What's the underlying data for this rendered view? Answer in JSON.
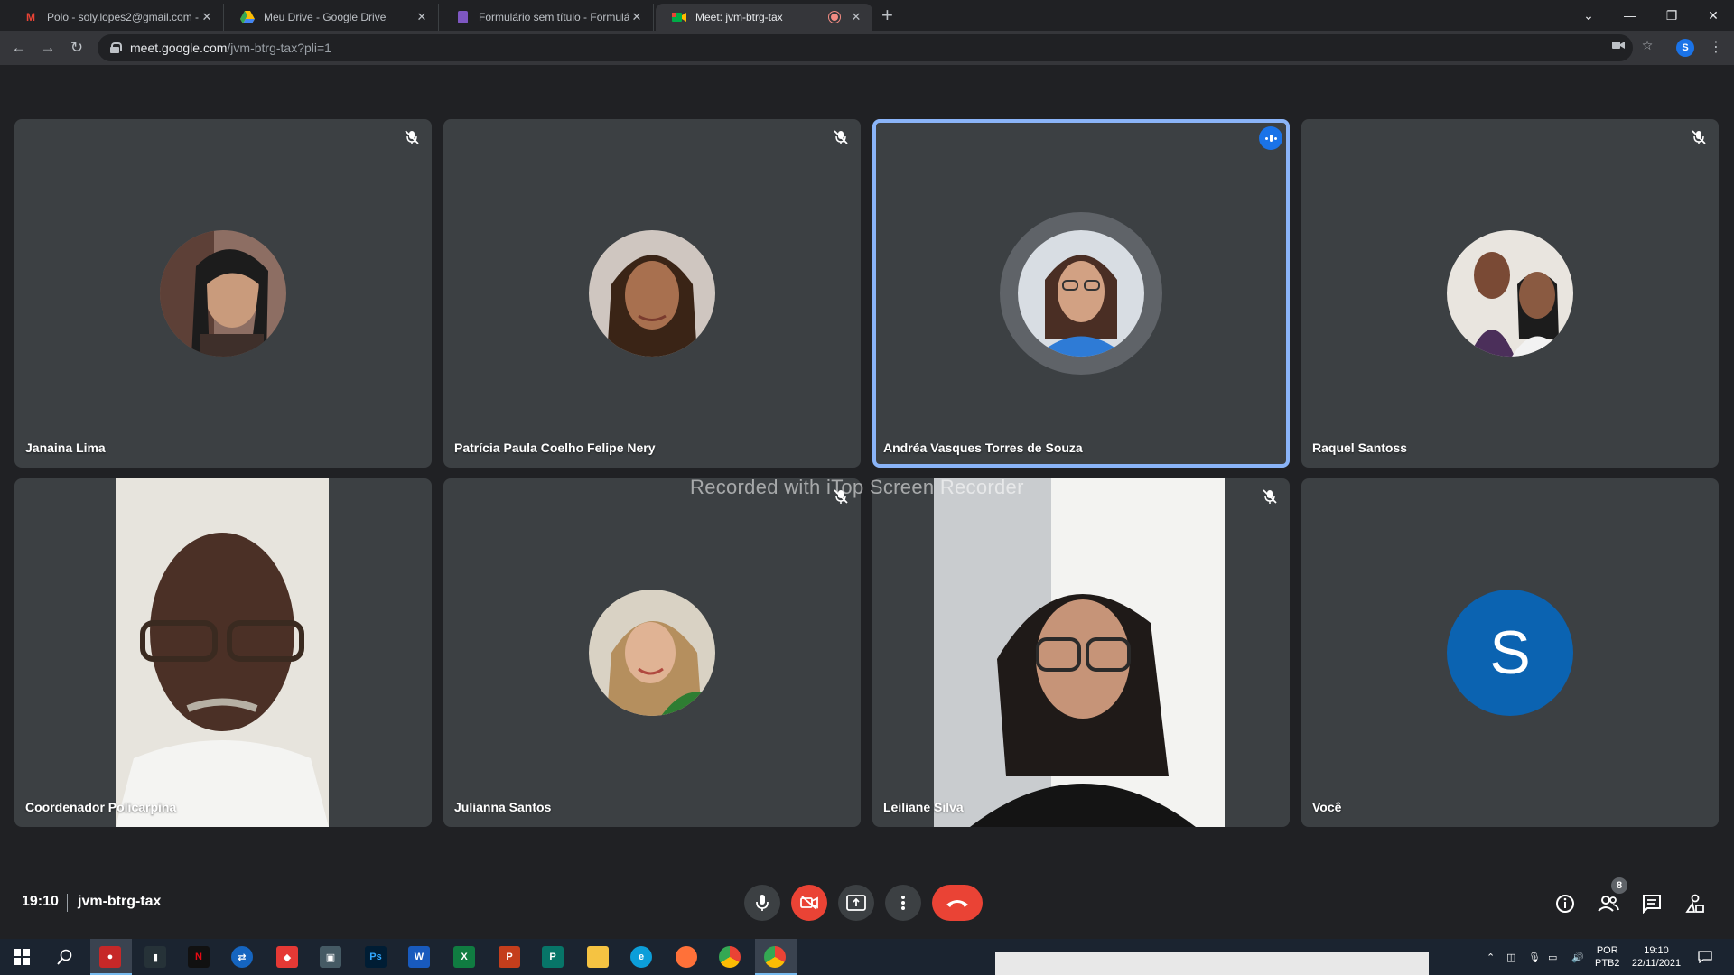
{
  "browser": {
    "tabs": [
      {
        "title": "Polo - soly.lopes2@gmail.com - G",
        "favicon": "gmail-icon"
      },
      {
        "title": "Meu Drive - Google Drive",
        "favicon": "drive-icon"
      },
      {
        "title": "Formulário sem título - Formulár",
        "favicon": "forms-icon"
      },
      {
        "title": "Meet: jvm-btrg-tax",
        "favicon": "meet-icon"
      }
    ],
    "url_host": "meet.google.com",
    "url_path": "/jvm-btrg-tax?pli=1",
    "profile_initial": "S"
  },
  "meeting": {
    "time": "19:10",
    "code": "jvm-btrg-tax",
    "participant_count": "8",
    "watermark": "Recorded with iTop Screen Recorder",
    "participants": [
      {
        "name": "Janaina Lima",
        "muted": true
      },
      {
        "name": "Patrícia Paula Coelho Felipe Nery",
        "muted": true
      },
      {
        "name": "Andréa Vasques Torres de Souza",
        "speaking": true
      },
      {
        "name": "Raquel Santoss",
        "muted": true
      },
      {
        "name": "Coordenador Policarpina",
        "video": true
      },
      {
        "name": "Julianna Santos",
        "muted": true
      },
      {
        "name": "Leiliane Silva",
        "muted": true,
        "video": true
      },
      {
        "name": "Você",
        "initial": "S"
      }
    ]
  },
  "taskbar": {
    "lang_line1": "POR",
    "lang_line2": "PTB2",
    "clock_time": "19:10",
    "clock_date": "22/11/2021",
    "apps": [
      "W",
      "X",
      "P",
      "P",
      "Ps"
    ]
  },
  "colors": {
    "background": "#202124",
    "tile": "#3c4043",
    "speaking_outline": "#8ab4f8",
    "hangup": "#ea4335",
    "you_avatar": "#0b63b1"
  }
}
